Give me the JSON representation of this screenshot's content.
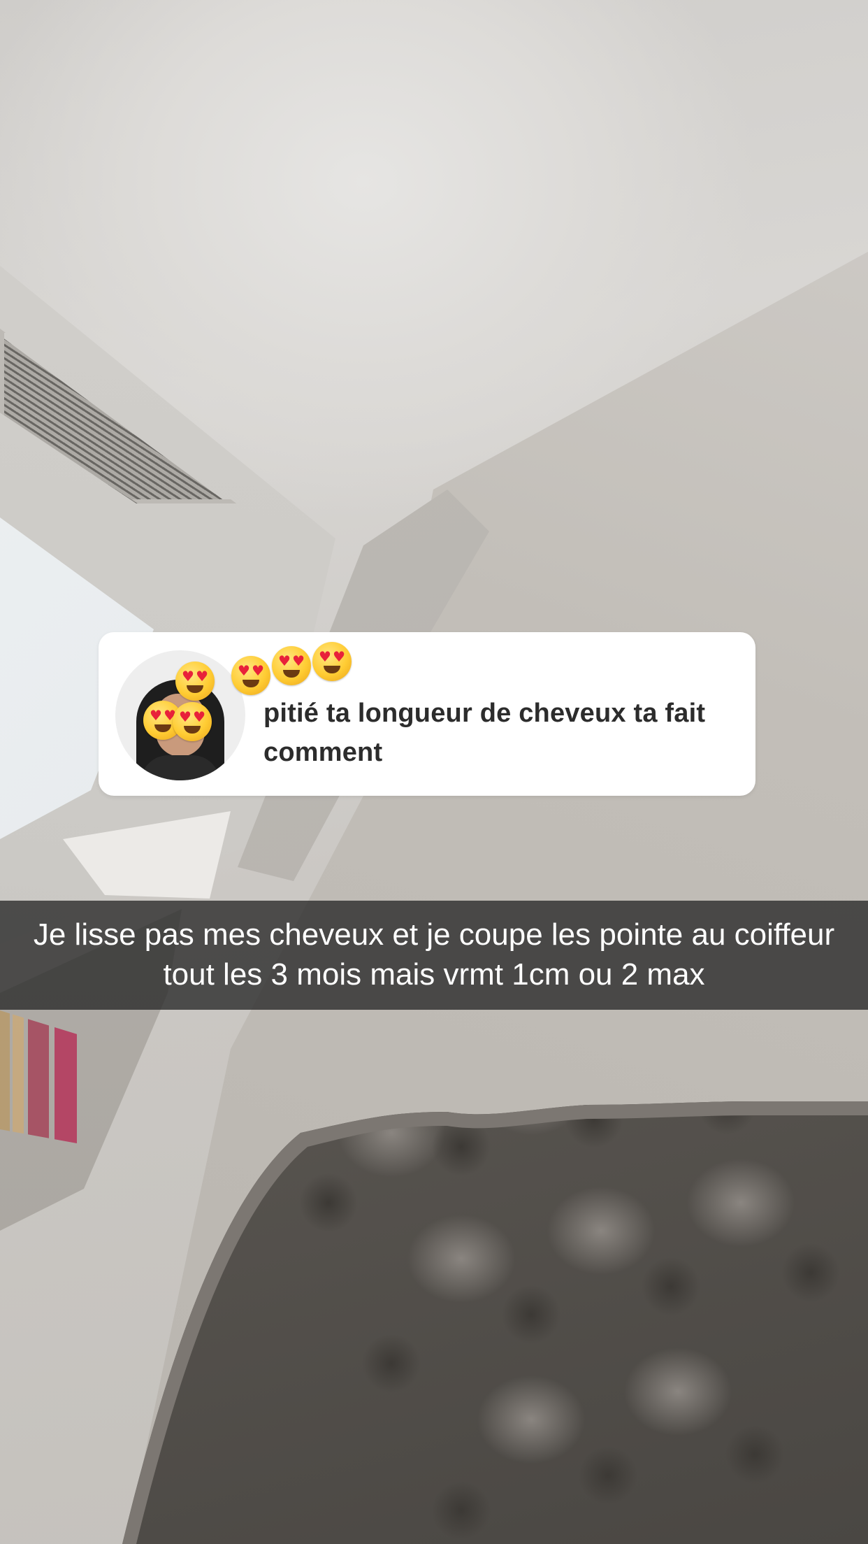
{
  "question_sticker": {
    "avatar_icon": "bitmoji-avatar-icon",
    "reaction_icons": [
      "heart-eyes-emoji-icon",
      "heart-eyes-emoji-icon",
      "heart-eyes-emoji-icon",
      "heart-eyes-emoji-icon",
      "heart-eyes-emoji-icon",
      "heart-eyes-emoji-icon"
    ],
    "text": "pitié ta longueur de cheveux ta fait comment"
  },
  "caption": {
    "text": "Je lisse pas mes cheveux et je coupe les pointe au coiffeur tout les 3 mois mais vrmt 1cm ou 2 max"
  },
  "colors": {
    "card_background": "#ffffff",
    "question_text": "#2c2c2c",
    "caption_bar": "#282828",
    "caption_text": "#ffffff",
    "emoji_heart": "#e8213a",
    "emoji_face": "#ffcc33"
  }
}
